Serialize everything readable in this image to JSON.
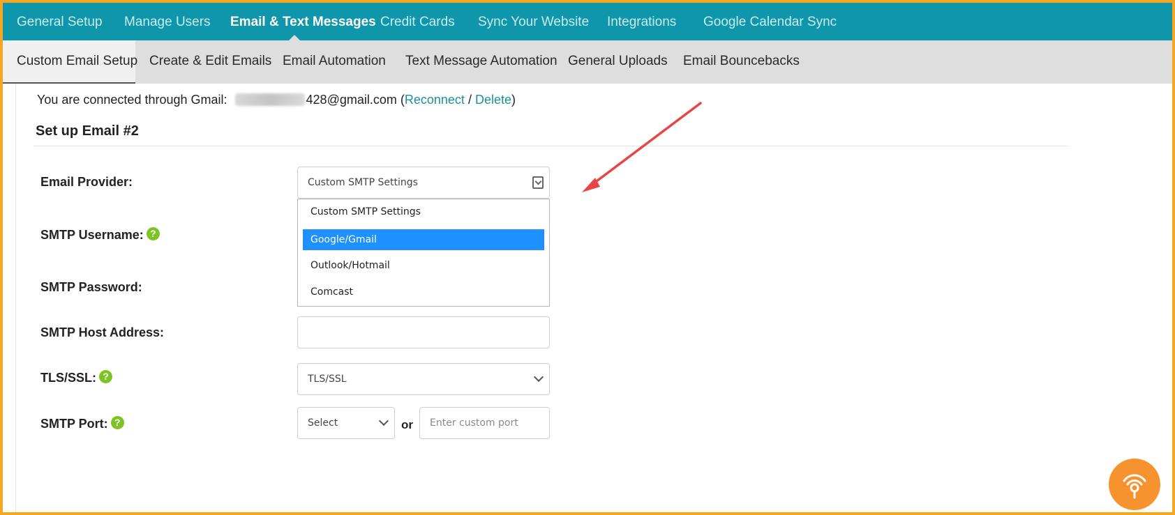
{
  "topnav": {
    "items": [
      {
        "label": "General Setup"
      },
      {
        "label": "Manage Users"
      },
      {
        "label": "Email & Text Messages"
      },
      {
        "label": "Credit Cards"
      },
      {
        "label": "Sync Your Website"
      },
      {
        "label": "Integrations"
      },
      {
        "label": "Google Calendar Sync"
      }
    ],
    "active": "Email & Text Messages",
    "color": "#0f96aa"
  },
  "subnav": {
    "items": [
      {
        "label": "Custom Email Setup"
      },
      {
        "label": "Create & Edit Emails"
      },
      {
        "label": "Email Automation"
      },
      {
        "label": "Text Message Automation"
      },
      {
        "label": "General Uploads"
      },
      {
        "label": "Email Bouncebacks"
      }
    ],
    "active": "Custom Email Setup"
  },
  "connection": {
    "prefix": "You are connected through Gmail:",
    "email_visible": "428@gmail.com",
    "open_paren": "(",
    "reconnect": "Reconnect",
    "slash": "/",
    "delete": "Delete",
    "close_paren": ")"
  },
  "section": {
    "title": "Set up Email #2"
  },
  "form": {
    "provider_label": "Email Provider:",
    "provider_value": "Custom SMTP Settings",
    "provider_options": [
      "Custom SMTP Settings",
      "Google/Gmail",
      "Outlook/Hotmail",
      "Comcast"
    ],
    "provider_highlighted": "Google/Gmail",
    "username_label": "SMTP Username:",
    "password_label": "SMTP Password:",
    "host_label": "SMTP Host Address:",
    "host_value": "",
    "tls_label": "TLS/SSL:",
    "tls_value": "TLS/SSL",
    "port_label": "SMTP Port:",
    "port_select": "Select",
    "or": "or",
    "port_placeholder": "Enter custom port",
    "help_glyph": "?"
  },
  "colors": {
    "accent": "#0f96aa",
    "link": "#1a8fa3",
    "selected_option": "#1e90ff",
    "help_icon": "#7cc424",
    "annotation_arrow": "#e84545",
    "chat_button": "#f7932f",
    "frame_border": "#f5a623"
  },
  "icons": {
    "help": "question-circle-icon",
    "dropdown": "dropdown-toggle-icon",
    "chat": "chat-beacon-icon"
  }
}
